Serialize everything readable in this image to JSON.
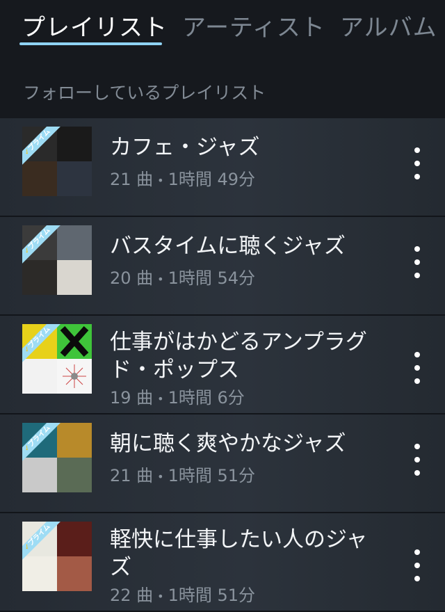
{
  "tabs": [
    {
      "label": "プレイリスト",
      "active": true
    },
    {
      "label": "アーティスト",
      "active": false
    },
    {
      "label": "アルバム",
      "active": false
    }
  ],
  "section": {
    "title": "フォローしているプレイリスト"
  },
  "badge": {
    "label": "プライム"
  },
  "playlists": [
    {
      "title": "カフェ・ジャズ",
      "tracks": "21 曲",
      "duration": "1時間 49分",
      "art": [
        "#2a2a2a",
        "#1a1a1a",
        "#3a2c20",
        "#2d3440"
      ]
    },
    {
      "title": "バスタイムに聴くジャズ",
      "tracks": "20 曲",
      "duration": "1時間 54分",
      "art": [
        "#3b3b3b",
        "#5f6770",
        "#2c2a28",
        "#d9d6cf"
      ]
    },
    {
      "title": "仕事がはかどるアンプラグド・ポップス",
      "tracks": "19 曲",
      "duration": "1時間 6分",
      "art": [
        "#e7d11a",
        "#3fc43a",
        "#f2f2f2",
        "#f6f6f6"
      ]
    },
    {
      "title": "朝に聴く爽やかなジャズ",
      "tracks": "21 曲",
      "duration": "1時間 51分",
      "art": [
        "#1f6a7a",
        "#b88a2a",
        "#c9c9c9",
        "#5a6b55"
      ]
    },
    {
      "title": "軽快に仕事したい人のジャズ",
      "tracks": "22 曲",
      "duration": "1時間 51分",
      "art": [
        "#e8e8e0",
        "#5a1e1a",
        "#f0eee6",
        "#a35a46"
      ]
    }
  ],
  "icons": {
    "more": "more-vertical-icon",
    "dot": "•"
  },
  "colors": {
    "accent": "#8fd3f4",
    "prime": "#9edcf4"
  }
}
